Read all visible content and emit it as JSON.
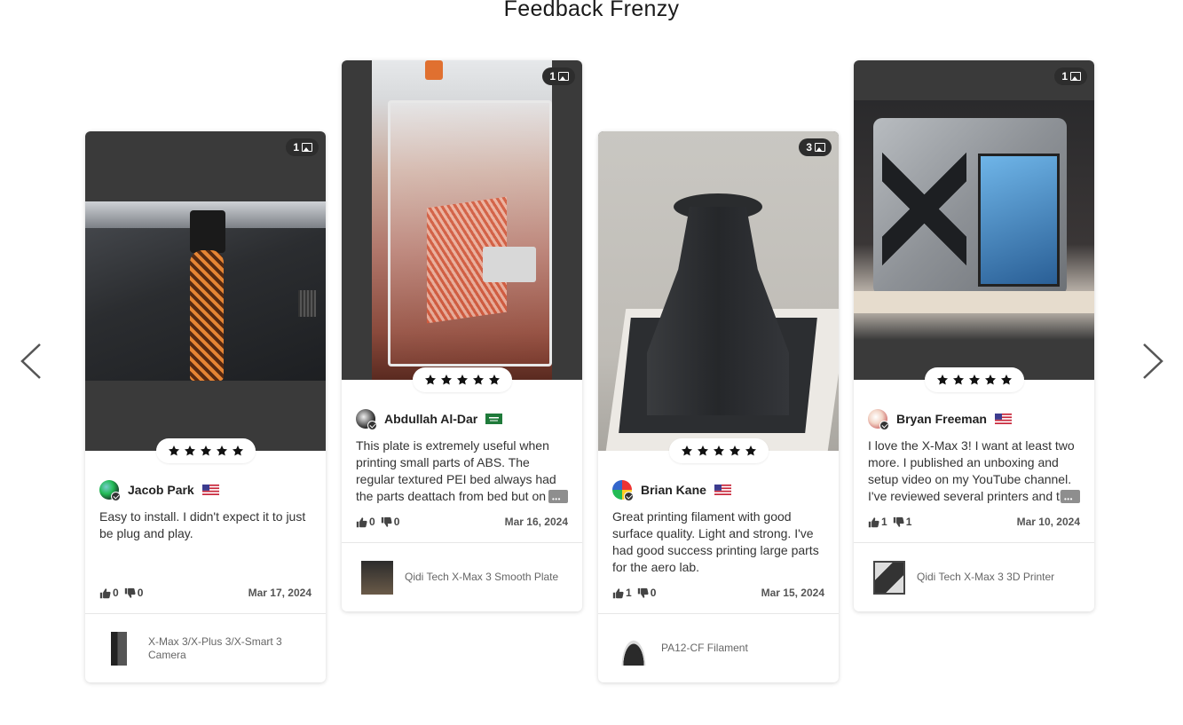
{
  "page": {
    "title": "Feedback Frenzy"
  },
  "nav": {
    "prev_icon": "chevron-left-icon",
    "next_icon": "chevron-right-icon"
  },
  "colors": {
    "star": "#111111",
    "card_dark": "#3a3a3a",
    "badge_bg": "#2d2d2d"
  },
  "reviews": [
    {
      "image_count": "1",
      "rating": 5,
      "author": "Jacob Park",
      "flag": "us-flag-icon",
      "text": "Easy to install. I didn't expect it to just be plug and play.",
      "likes": "0",
      "dislikes": "0",
      "date": "Mar 17, 2024",
      "product": "X-Max 3/X-Plus 3/X-Smart 3 Camera",
      "photo": "3d-printed-lattice-vase-photo"
    },
    {
      "image_count": "1",
      "rating": 5,
      "author": "Abdullah Al-Dar",
      "flag": "saudi-flag-icon",
      "text": "This plate is extremely useful when printing small parts of ABS. The regular textured PEI bed always had the parts deattach from bed but on the smooth PEI sheet they stuc",
      "likes": "0",
      "dislikes": "0",
      "date": "Mar 16, 2024",
      "product": "Qidi Tech X-Max 3 Smooth Plate",
      "photo": "printer-build-plate-photo"
    },
    {
      "image_count": "3",
      "rating": 5,
      "author": "Brian Kane",
      "flag": "us-flag-icon",
      "text": "Great printing filament with good surface quality. Light and strong. I've had good success printing large parts for the aero lab.",
      "likes": "1",
      "dislikes": "0",
      "date": "Mar 15, 2024",
      "product": "PA12-CF Filament",
      "photo": "black-printed-duct-photo"
    },
    {
      "image_count": "1",
      "rating": 5,
      "author": "Bryan Freeman",
      "flag": "us-flag-icon",
      "text": "I love the X-Max 3! I want at least two more. I published an unboxing and setup video on my YouTube channel. I've reviewed several printers and this is my favorite.",
      "likes": "1",
      "dislikes": "1",
      "date": "Mar 10, 2024",
      "product": "Qidi Tech X-Max 3 3D Printer",
      "photo": "x-max-3-printer-photo"
    }
  ]
}
